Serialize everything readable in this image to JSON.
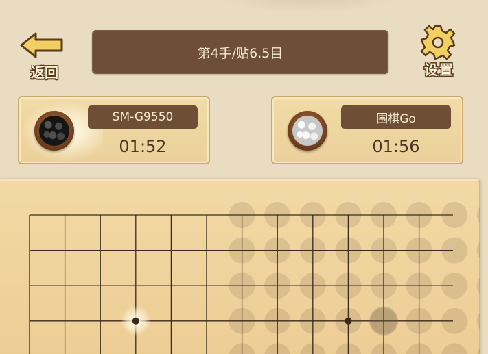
{
  "header": {
    "back_label": "返回",
    "title": "第4手/贴6.5目",
    "settings_label": "设置"
  },
  "players": {
    "black": {
      "name": "SM-G9550",
      "time": "01:52"
    },
    "white": {
      "name": "围棋Go",
      "time": "01:56"
    }
  },
  "board": {
    "columns": 13,
    "rows": 5,
    "hint_dots": [
      [
        6,
        0
      ],
      [
        7,
        0
      ],
      [
        8,
        0
      ],
      [
        9,
        0
      ],
      [
        10,
        0
      ],
      [
        11,
        0
      ],
      [
        12,
        0
      ],
      [
        13,
        0
      ],
      [
        6,
        1
      ],
      [
        7,
        1
      ],
      [
        8,
        1
      ],
      [
        9,
        1
      ],
      [
        10,
        1
      ],
      [
        11,
        1
      ],
      [
        12,
        1
      ],
      [
        13,
        1
      ],
      [
        6,
        2
      ],
      [
        7,
        2
      ],
      [
        8,
        2
      ],
      [
        9,
        2
      ],
      [
        10,
        2
      ],
      [
        11,
        2
      ],
      [
        12,
        2
      ],
      [
        13,
        2
      ],
      [
        6,
        3
      ],
      [
        7,
        3
      ],
      [
        8,
        3
      ],
      [
        9,
        3
      ],
      [
        10,
        3
      ],
      [
        11,
        3
      ],
      [
        12,
        3
      ],
      [
        13,
        3
      ],
      [
        6,
        4
      ],
      [
        7,
        4
      ],
      [
        8,
        4
      ],
      [
        9,
        4
      ],
      [
        10,
        4
      ],
      [
        11,
        4
      ],
      [
        12,
        4
      ],
      [
        13,
        4
      ]
    ],
    "star_points": [
      [
        3,
        3
      ],
      [
        9,
        3
      ]
    ],
    "glow_point": [
      3,
      3
    ],
    "large_dot": [
      10,
      3
    ]
  },
  "colors": {
    "accent_brown": "#6e4e37",
    "board_wood": "#f3d9a5",
    "background": "#e9dcc0"
  }
}
